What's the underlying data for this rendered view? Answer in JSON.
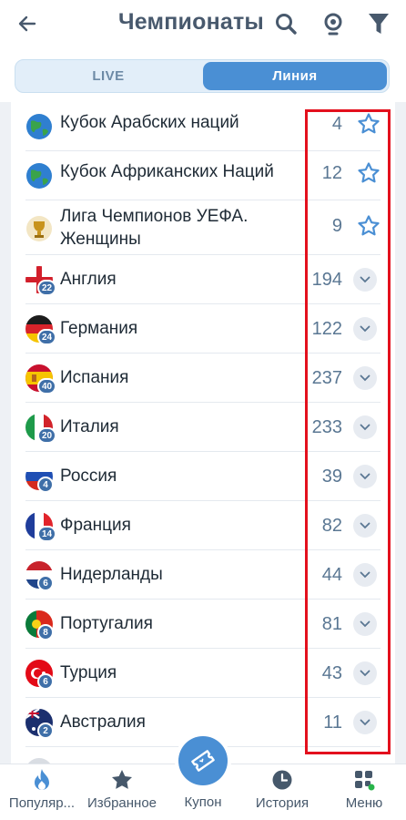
{
  "header": {
    "title": "Чемпионаты"
  },
  "tabs": [
    {
      "label": "LIVE"
    },
    {
      "label": "Линия"
    }
  ],
  "competitions": [
    {
      "name": "Кубок Арабских наций",
      "count": "4",
      "icon": "globe-icon",
      "action": "star"
    },
    {
      "name": "Кубок Африканских Наций",
      "count": "12",
      "icon": "globe-icon",
      "action": "star"
    },
    {
      "name": "Лига Чемпионов УЕФА. Женщины",
      "count": "9",
      "icon": "trophy-icon",
      "action": "star"
    },
    {
      "name": "Англия",
      "count": "194",
      "badge": "22",
      "icon": "flag-england",
      "action": "expand"
    },
    {
      "name": "Германия",
      "count": "122",
      "badge": "24",
      "icon": "flag-germany",
      "action": "expand"
    },
    {
      "name": "Испания",
      "count": "237",
      "badge": "40",
      "icon": "flag-spain",
      "action": "expand"
    },
    {
      "name": "Италия",
      "count": "233",
      "badge": "20",
      "icon": "flag-italy",
      "action": "expand"
    },
    {
      "name": "Россия",
      "count": "39",
      "badge": "4",
      "icon": "flag-russia",
      "action": "expand"
    },
    {
      "name": "Франция",
      "count": "82",
      "badge": "14",
      "icon": "flag-france",
      "action": "expand"
    },
    {
      "name": "Нидерланды",
      "count": "44",
      "badge": "6",
      "icon": "flag-netherlands",
      "action": "expand"
    },
    {
      "name": "Португалия",
      "count": "81",
      "badge": "8",
      "icon": "flag-portugal",
      "action": "expand"
    },
    {
      "name": "Турция",
      "count": "43",
      "badge": "6",
      "icon": "flag-turkey",
      "action": "expand"
    },
    {
      "name": "Австралия",
      "count": "11",
      "badge": "2",
      "icon": "flag-australia",
      "action": "expand"
    }
  ],
  "bottom_nav": [
    {
      "label": "Популяр...",
      "icon": "flame-icon"
    },
    {
      "label": "Избранное",
      "icon": "star-icon"
    },
    {
      "label": "Купон",
      "icon": "ticket-icon"
    },
    {
      "label": "История",
      "icon": "clock-icon"
    },
    {
      "label": "Меню",
      "icon": "grid-icon"
    }
  ],
  "colors": {
    "accent": "#4a8fd4",
    "highlight": "#e3101d",
    "count_text": "#5a7793"
  }
}
